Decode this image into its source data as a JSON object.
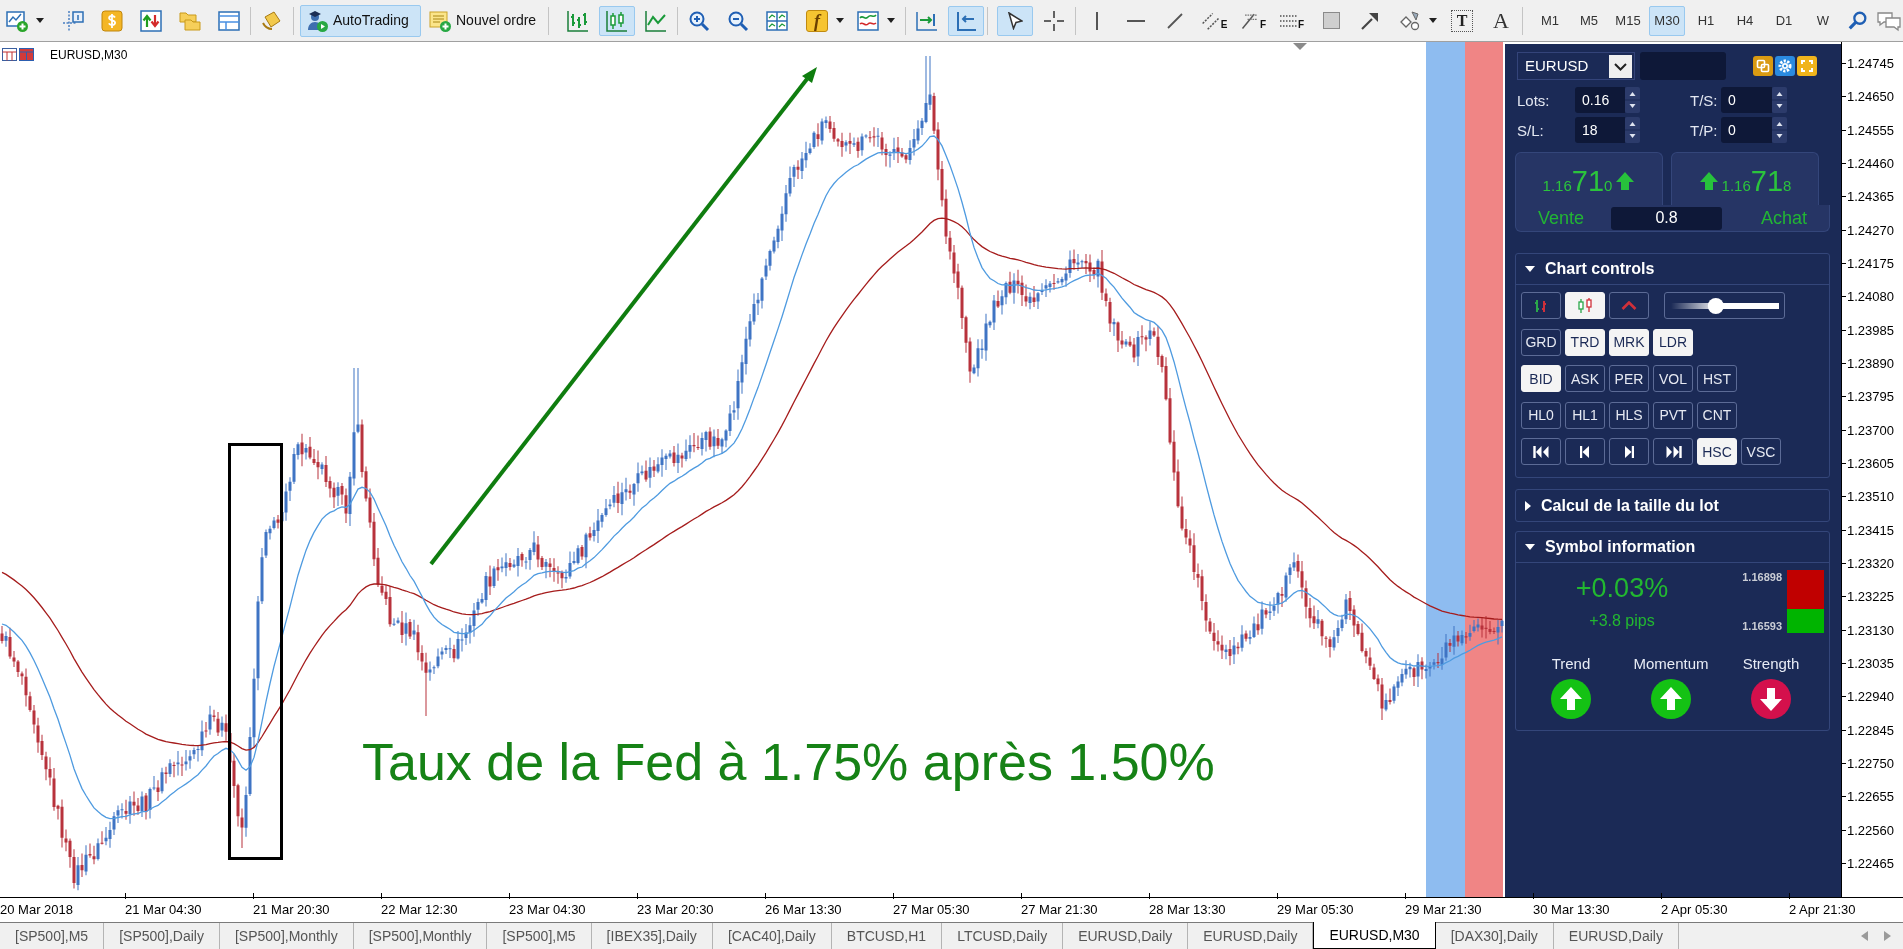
{
  "toolbar": {
    "autotrading": {
      "label": "AutoTrading",
      "on": true
    },
    "new_order": {
      "label": "Nouvel ordre"
    },
    "chart_types": [
      {
        "kind": "bars",
        "selected": false
      },
      {
        "kind": "candles",
        "selected": true
      },
      {
        "kind": "line",
        "selected": false
      }
    ],
    "indicators": {
      "letter": "f"
    },
    "scrolling": [
      {
        "kind": "shift",
        "on": false
      },
      {
        "kind": "autoscroll",
        "on": true
      }
    ],
    "pointers": [
      {
        "kind": "cursor",
        "selected": true
      },
      {
        "kind": "crosshair",
        "selected": false
      }
    ],
    "objects": [
      {
        "kind": "vline"
      },
      {
        "kind": "hline"
      },
      {
        "kind": "trend"
      },
      {
        "kind": "channel",
        "letter": "E"
      },
      {
        "kind": "fibo",
        "letter": "F"
      },
      {
        "kind": "levels",
        "letter": "F"
      },
      {
        "kind": "rectangle"
      },
      {
        "kind": "arrow"
      },
      {
        "kind": "shapes"
      },
      {
        "kind": "text",
        "letter": "T"
      },
      {
        "kind": "label",
        "letter": "A"
      }
    ],
    "timeframes": [
      {
        "label": "M1",
        "selected": false
      },
      {
        "label": "M5",
        "selected": false
      },
      {
        "label": "M15",
        "selected": false
      },
      {
        "label": "M30",
        "selected": true
      },
      {
        "label": "H1",
        "selected": false
      },
      {
        "label": "H4",
        "selected": false
      },
      {
        "label": "D1",
        "selected": false
      },
      {
        "label": "W",
        "selected": false
      }
    ]
  },
  "chart": {
    "title": "EURUSD,M30",
    "annotation": "Taux de la Fed à 1.75% après 1.50%",
    "bands": [
      {
        "color": "#8ebcf0"
      },
      {
        "color": "#f08585"
      }
    ],
    "price_labels": [
      "1.24745",
      "1.24650",
      "1.24555",
      "1.24460",
      "1.24365",
      "1.24270",
      "1.24175",
      "1.24080",
      "1.23985",
      "1.23890",
      "1.23795",
      "1.23700",
      "1.23605",
      "1.23510",
      "1.23415",
      "1.23320",
      "1.23225",
      "1.23130",
      "1.23035",
      "1.22940",
      "1.22845",
      "1.22750",
      "1.22655",
      "1.22560",
      "1.22465"
    ],
    "time_labels": [
      "20 Mar 2018",
      "21 Mar 04:30",
      "21 Mar 20:30",
      "22 Mar 12:30",
      "23 Mar 04:30",
      "23 Mar 20:30",
      "26 Mar 13:30",
      "27 Mar 05:30",
      "27 Mar 21:30",
      "28 Mar 13:30",
      "29 Mar 05:30",
      "29 Mar 21:30",
      "30 Mar 13:30",
      "2 Apr 05:30",
      "2 Apr 21:30"
    ]
  },
  "panel": {
    "symbol": "EURUSD",
    "fields": [
      {
        "label": "Lots:",
        "value": "0.16"
      },
      {
        "label": "T/S:",
        "value": "0"
      },
      {
        "label": "S/L:",
        "value": "18"
      },
      {
        "label": "T/P:",
        "value": "0"
      }
    ],
    "sell": {
      "price": [
        "1.16",
        "71",
        "0"
      ],
      "rising": true,
      "label": "Vente"
    },
    "buy": {
      "price": [
        "1.16",
        "71",
        "8"
      ],
      "rising": true,
      "label": "Achat"
    },
    "spread": "0.8",
    "chart_controls": {
      "title": "Chart controls",
      "expanded": true,
      "chart_types": [
        {
          "kind": "bars",
          "selected": false
        },
        {
          "kind": "candles",
          "selected": true
        },
        {
          "kind": "line",
          "selected": false
        }
      ],
      "zoom": {
        "level": 0.4
      },
      "button_rows": [
        [
          {
            "kind": "text",
            "label": "GRD",
            "on": false
          },
          {
            "kind": "text",
            "label": "TRD",
            "on": true
          },
          {
            "kind": "text",
            "label": "MRK",
            "on": true
          },
          {
            "kind": "text",
            "label": "LDR",
            "on": true
          }
        ],
        [
          {
            "kind": "text",
            "label": "BID",
            "on": true
          },
          {
            "kind": "text",
            "label": "ASK",
            "on": false
          },
          {
            "kind": "text",
            "label": "PER",
            "on": false
          },
          {
            "kind": "text",
            "label": "VOL",
            "on": false
          },
          {
            "kind": "text",
            "label": "HST",
            "on": false
          }
        ],
        [
          {
            "kind": "text",
            "label": "HL0",
            "on": false
          },
          {
            "kind": "text",
            "label": "HL1",
            "on": false
          },
          {
            "kind": "text",
            "label": "HLS",
            "on": false
          },
          {
            "kind": "text",
            "label": "PVT",
            "on": false
          },
          {
            "kind": "text",
            "label": "CNT",
            "on": false
          }
        ],
        [
          {
            "kind": "first",
            "on": false
          },
          {
            "kind": "previous",
            "on": false
          },
          {
            "kind": "next",
            "on": false
          },
          {
            "kind": "last",
            "on": false
          },
          {
            "kind": "text",
            "label": "HSC",
            "on": true
          },
          {
            "kind": "text",
            "label": "VSC",
            "on": false
          }
        ]
      ]
    },
    "lot_calculator": {
      "title": "Calcul de la taille du lot",
      "expanded": false
    },
    "symbol_info": {
      "title": "Symbol information",
      "expanded": true,
      "change": "+0.03%",
      "pips": "+3.8 pips",
      "high": "1.16898",
      "low": "1.16593",
      "level": 0.38,
      "signals": [
        {
          "label": "Trend",
          "up": true
        },
        {
          "label": "Momentum",
          "up": true
        },
        {
          "label": "Strength",
          "up": false
        }
      ]
    }
  },
  "tabs": [
    {
      "label": "[SP500],M5",
      "selected": false
    },
    {
      "label": "[SP500],Daily",
      "selected": false
    },
    {
      "label": "[SP500],Monthly",
      "selected": false
    },
    {
      "label": "[SP500],Monthly",
      "selected": false
    },
    {
      "label": "[SP500],M5",
      "selected": false
    },
    {
      "label": "[IBEX35],Daily",
      "selected": false
    },
    {
      "label": "[CAC40],Daily",
      "selected": false
    },
    {
      "label": "BTCUSD,H1",
      "selected": false
    },
    {
      "label": "LTCUSD,Daily",
      "selected": false
    },
    {
      "label": "EURUSD,Daily",
      "selected": false
    },
    {
      "label": "EURUSD,Daily",
      "selected": false
    },
    {
      "label": "EURUSD,M30",
      "selected": true
    },
    {
      "label": "[DAX30],Daily",
      "selected": false
    },
    {
      "label": "EURUSD,Daily",
      "selected": false
    }
  ]
}
